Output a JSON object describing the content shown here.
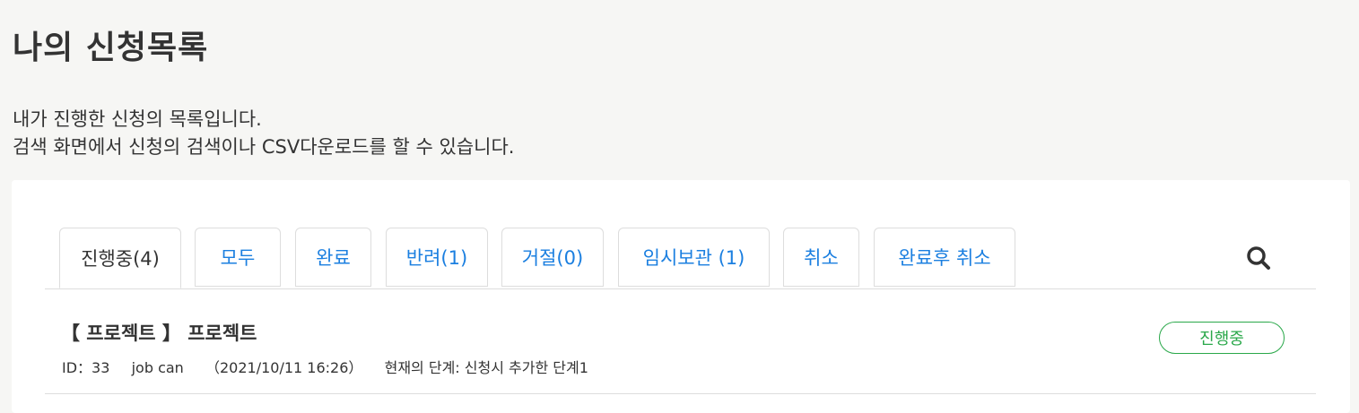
{
  "header": {
    "title": "나의 신청목록",
    "description_line1": "내가 진행한 신청의 목록입니다.",
    "description_line2": "검색 화면에서 신청의 검색이나 CSV다운로드를 할 수 있습니다."
  },
  "tabs": [
    {
      "label": "진행중(4)",
      "active": true
    },
    {
      "label": "모두",
      "active": false
    },
    {
      "label": "완료",
      "active": false
    },
    {
      "label": "반려(1)",
      "active": false
    },
    {
      "label": "거절(0)",
      "active": false
    },
    {
      "label": "임시보관 (1)",
      "active": false
    },
    {
      "label": "취소",
      "active": false
    },
    {
      "label": "완료후 취소",
      "active": false
    }
  ],
  "search": {
    "icon": "search-icon"
  },
  "colors": {
    "link": "#1b7fe0",
    "status_green": "#2aa84a",
    "background": "#f6f6f4"
  },
  "requests": [
    {
      "title": "【 프로젝트 】 프로젝트",
      "id_text": "ID：33",
      "user": "job can",
      "date": "（2021/10/11 16:26）",
      "step": "현재의 단계: 신청시 추가한 단계1",
      "status": "진행중"
    }
  ]
}
